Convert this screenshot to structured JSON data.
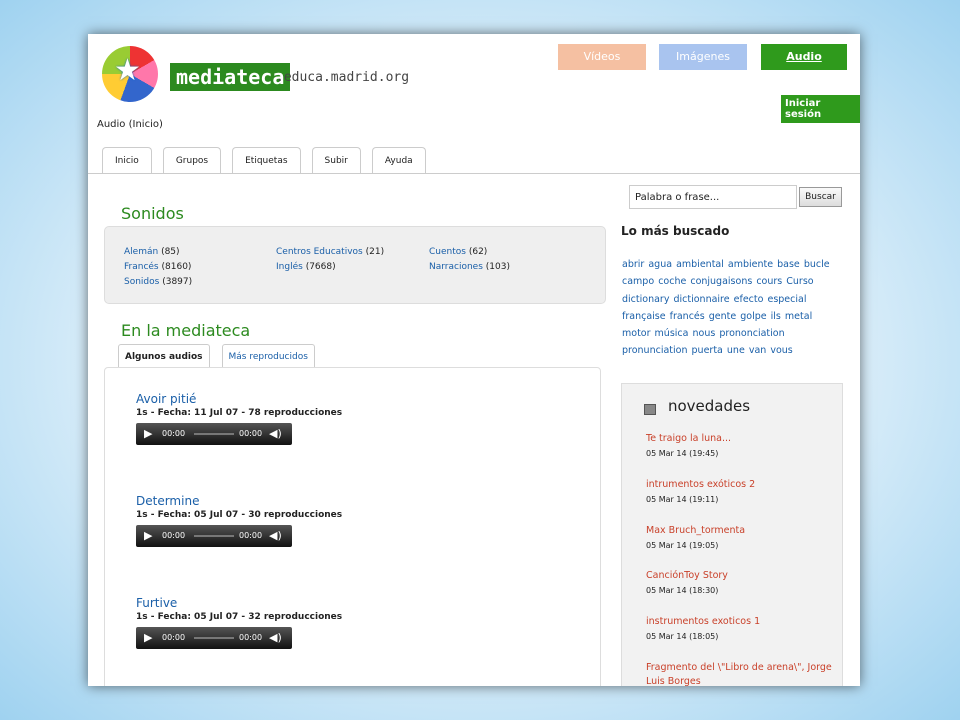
{
  "header": {
    "brand": "mediateca",
    "domain": ".educa.madrid.org",
    "nav": [
      {
        "label": "Vídeos",
        "color": "#f5c0a2"
      },
      {
        "label": "Imágenes",
        "color": "#a9c4ef"
      },
      {
        "label": "Audio",
        "color": "#2f9a1c"
      }
    ],
    "login": "Iniciar sesión",
    "breadcrumb": "Audio (Inicio)"
  },
  "tabs": [
    "Inicio",
    "Grupos",
    "Etiquetas",
    "Subir",
    "Ayuda"
  ],
  "sonidos": {
    "title": "Sonidos",
    "categories": [
      {
        "name": "Alemán",
        "count": "(85)"
      },
      {
        "name": "Francés",
        "count": "(8160)"
      },
      {
        "name": "Sonidos",
        "count": "(3897)"
      },
      {
        "name": "Centros Educativos",
        "count": "(21)"
      },
      {
        "name": "Inglés",
        "count": "(7668)"
      },
      {
        "name": "Cuentos",
        "count": "(62)"
      },
      {
        "name": "Narraciones",
        "count": "(103)"
      }
    ]
  },
  "mediateca": {
    "title": "En la mediateca",
    "subtabs": [
      "Algunos audios",
      "Más reproducidos"
    ],
    "tracks": [
      {
        "title": "Avoir pitié",
        "meta": "1s - Fecha: 11 Jul 07 - 78 reproducciones",
        "time_start": "00:00",
        "time_end": "00:00"
      },
      {
        "title": "Determine",
        "meta": "1s - Fecha: 05 Jul 07 - 30 reproducciones",
        "time_start": "00:00",
        "time_end": "00:00"
      },
      {
        "title": "Furtive",
        "meta": "1s - Fecha: 05 Jul 07 - 32 reproducciones",
        "time_start": "00:00",
        "time_end": "00:00"
      }
    ]
  },
  "search": {
    "value": "Palabra o frase...",
    "button": "Buscar"
  },
  "mas_buscado": {
    "title": "Lo más buscado",
    "tags": [
      "abrir",
      "agua",
      "ambiental",
      "ambiente",
      "base",
      "bucle",
      "campo",
      "coche",
      "conjugaisons",
      "cours",
      "Curso",
      "dictionary",
      "dictionnaire",
      "efecto",
      "especial",
      "française",
      "francés",
      "gente",
      "golpe",
      "ils",
      "metal",
      "motor",
      "música",
      "nous",
      "prononciation",
      "pronunciation",
      "puerta",
      "une",
      "van",
      "vous"
    ]
  },
  "novedades": {
    "title": "novedades",
    "items": [
      {
        "title": "Te traigo la luna...",
        "date": "05 Mar 14 (19:45)"
      },
      {
        "title": "intrumentos exóticos 2",
        "date": "05 Mar 14 (19:11)"
      },
      {
        "title": "Max Bruch_tormenta",
        "date": "05 Mar 14 (19:05)"
      },
      {
        "title": "CanciónToy Story",
        "date": "05 Mar 14 (18:30)"
      },
      {
        "title": "instrumentos exoticos 1",
        "date": "05 Mar 14 (18:05)"
      },
      {
        "title": "Fragmento del \\\"Libro de arena\\\", Jorge Luis Borges",
        "date": ""
      }
    ]
  }
}
